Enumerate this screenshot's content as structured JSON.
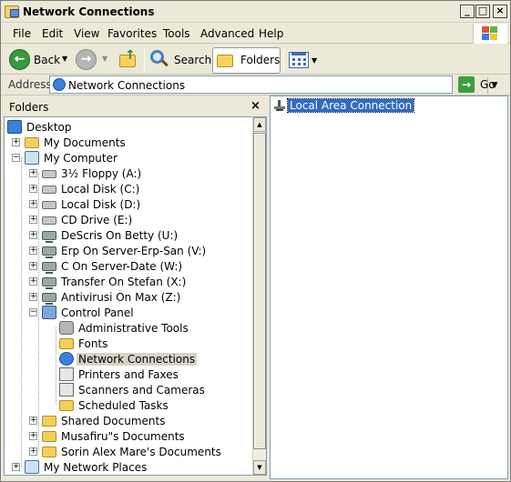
{
  "window": {
    "title": "Network Connections"
  },
  "menu": [
    "File",
    "Edit",
    "View",
    "Favorites",
    "Tools",
    "Advanced",
    "Help"
  ],
  "toolbar": {
    "back_label": "Back",
    "search_label": "Search",
    "folders_label": "Folders"
  },
  "address": {
    "label": "Address",
    "value": "Network Connections",
    "go_label": "Go"
  },
  "folders_pane": {
    "title": "Folders"
  },
  "tree": [
    {
      "label": "Desktop",
      "icon": "desktop-icon",
      "level": 0,
      "expander": ""
    },
    {
      "label": "My Documents",
      "icon": "folder-icon",
      "level": 1,
      "expander": "+"
    },
    {
      "label": "My Computer",
      "icon": "computer-icon",
      "level": 1,
      "expander": "−"
    },
    {
      "label": "3½ Floppy (A:)",
      "icon": "floppy-icon",
      "level": 2,
      "expander": "+"
    },
    {
      "label": "Local Disk (C:)",
      "icon": "drive-icon",
      "level": 2,
      "expander": "+"
    },
    {
      "label": "Local Disk (D:)",
      "icon": "drive-icon",
      "level": 2,
      "expander": "+"
    },
    {
      "label": "CD Drive (E:)",
      "icon": "cd-drive-icon",
      "level": 2,
      "expander": "+"
    },
    {
      "label": "DeScris On Betty (U:)",
      "icon": "network-drive-icon",
      "level": 2,
      "expander": "+"
    },
    {
      "label": "Erp On Server-Erp-San (V:)",
      "icon": "network-drive-icon",
      "level": 2,
      "expander": "+"
    },
    {
      "label": "C On Server-Date (W:)",
      "icon": "network-drive-icon",
      "level": 2,
      "expander": "+"
    },
    {
      "label": "Transfer On Stefan (X:)",
      "icon": "network-drive-icon",
      "level": 2,
      "expander": "+"
    },
    {
      "label": "Antivirusi On Max (Z:)",
      "icon": "network-drive-icon",
      "level": 2,
      "expander": "+"
    },
    {
      "label": "Control Panel",
      "icon": "control-panel-icon",
      "level": 2,
      "expander": "−"
    },
    {
      "label": "Administrative Tools",
      "icon": "admin-tools-icon",
      "level": 3,
      "expander": ""
    },
    {
      "label": "Fonts",
      "icon": "fonts-folder-icon",
      "level": 3,
      "expander": ""
    },
    {
      "label": "Network Connections",
      "icon": "network-connections-icon",
      "level": 3,
      "expander": "",
      "selected": true
    },
    {
      "label": "Printers and Faxes",
      "icon": "printer-icon",
      "level": 3,
      "expander": ""
    },
    {
      "label": "Scanners and Cameras",
      "icon": "scanner-icon",
      "level": 3,
      "expander": ""
    },
    {
      "label": "Scheduled Tasks",
      "icon": "scheduled-tasks-icon",
      "level": 3,
      "expander": ""
    },
    {
      "label": "Shared Documents",
      "icon": "folder-icon",
      "level": 2,
      "expander": "+"
    },
    {
      "label": "Musafiru\"s Documents",
      "icon": "folder-icon",
      "level": 2,
      "expander": "+"
    },
    {
      "label": "Sorin Alex Mare's Documents",
      "icon": "folder-icon",
      "level": 2,
      "expander": "+"
    },
    {
      "label": "My Network Places",
      "icon": "network-places-icon",
      "level": 1,
      "expander": "+"
    }
  ],
  "content": {
    "items": [
      {
        "label": "Local Area Connection",
        "icon": "lan-connection-icon",
        "selected": true
      }
    ]
  }
}
